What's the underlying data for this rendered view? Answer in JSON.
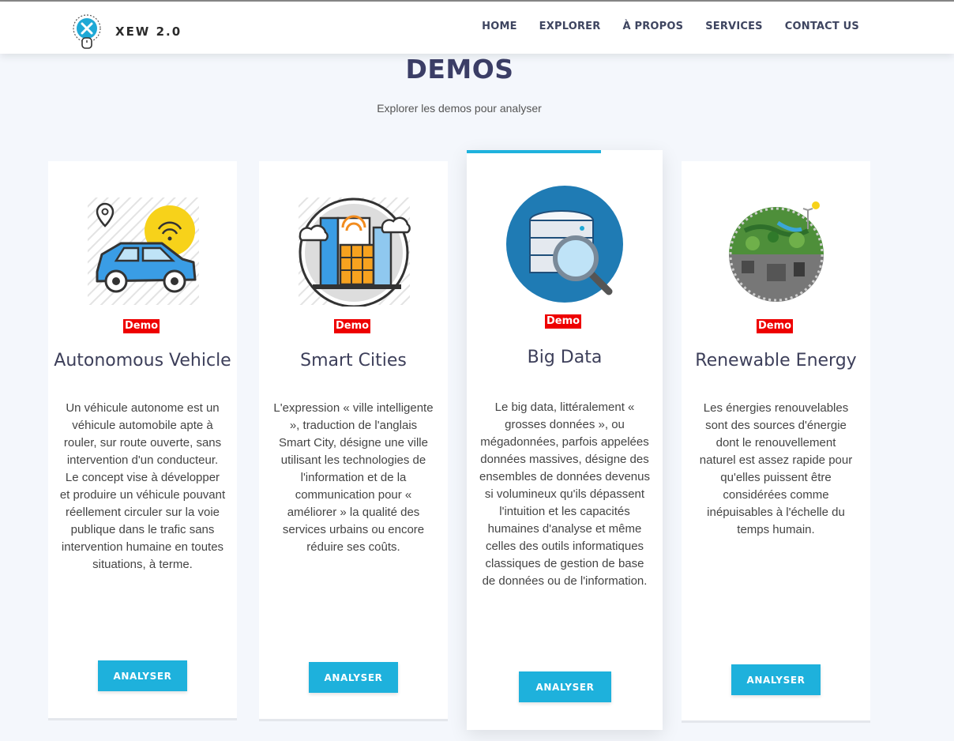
{
  "brand": {
    "name": "XEW 2.0",
    "logo_icon": "x-badge-logo"
  },
  "nav": {
    "items": [
      "HOME",
      "EXPLORER",
      "À PROPOS",
      "SERVICES",
      "CONTACT US"
    ]
  },
  "section": {
    "title": "DEMOS",
    "subtitle": "Explorer les demos pour analyser"
  },
  "colors": {
    "accent": "#1eb1dc",
    "badge": "#ee0000",
    "heading": "#3b3e66",
    "background": "#f4f7fc"
  },
  "cards": [
    {
      "badge": "Demo",
      "title": "Autonomous Vehicle",
      "text": "Un véhicule autonome est un véhicule automobile apte à rouler, sur route ouverte, sans intervention d'un conducteur. Le concept vise à développer et produire un véhicule pouvant réellement circuler sur la voie publique dans le trafic sans intervention humaine en toutes situations, à terme.",
      "button": "ANALYSER",
      "icon": "car-icon"
    },
    {
      "badge": "Demo",
      "title": "Smart Cities",
      "text": "L'expression « ville intelligente », traduction de l'anglais Smart City, désigne une ville utilisant les technologies de l'information et de la communication pour « améliorer » la qualité des services urbains ou encore réduire ses coûts.",
      "button": "ANALYSER",
      "icon": "city-icon"
    },
    {
      "badge": "Demo",
      "title": "Big Data",
      "text": "Le big data, littéralement « grosses données », ou mégadonnées, parfois appelées données massives, désigne des ensembles de données devenus si volumineux qu'ils dépassent l'intuition et les capacités humaines d'analyse et même celles des outils informatiques classiques de gestion de base de données ou de l'information.",
      "button": "ANALYSER",
      "icon": "database-search-icon"
    },
    {
      "badge": "Demo",
      "title": "Renewable Energy",
      "text": "Les énergies renouvelables sont des sources d'énergie dont le renouvellement naturel est assez rapide pour qu'elles puissent être considérées comme inépuisables à l'échelle du temps humain.",
      "button": "ANALYSER",
      "icon": "planet-energy-icon"
    }
  ]
}
